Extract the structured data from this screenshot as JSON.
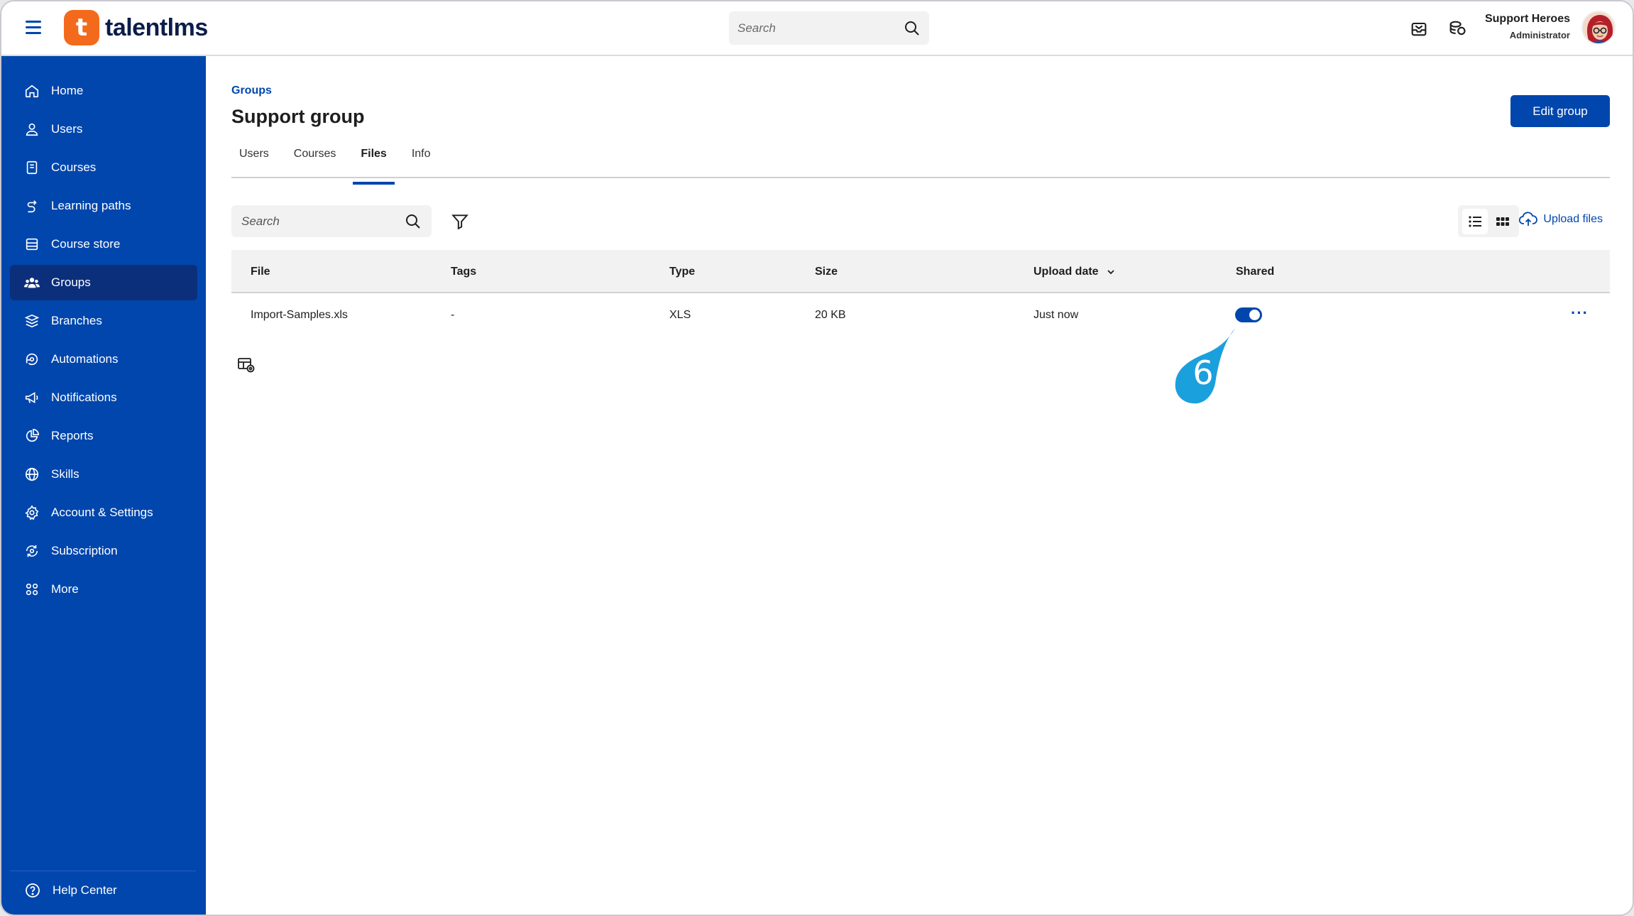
{
  "header": {
    "logo_text": "talentlms",
    "logo_letter": "t",
    "search_placeholder": "Search",
    "user_name": "Support Heroes",
    "user_role": "Administrator"
  },
  "sidebar": {
    "items": [
      {
        "label": "Home",
        "icon": "home-icon"
      },
      {
        "label": "Users",
        "icon": "user-icon"
      },
      {
        "label": "Courses",
        "icon": "book-icon"
      },
      {
        "label": "Learning paths",
        "icon": "path-icon"
      },
      {
        "label": "Course store",
        "icon": "store-icon"
      },
      {
        "label": "Groups",
        "icon": "groups-icon",
        "active": true
      },
      {
        "label": "Branches",
        "icon": "branches-icon"
      },
      {
        "label": "Automations",
        "icon": "automations-icon"
      },
      {
        "label": "Notifications",
        "icon": "megaphone-icon"
      },
      {
        "label": "Reports",
        "icon": "pie-chart-icon"
      },
      {
        "label": "Skills",
        "icon": "globe-icon"
      },
      {
        "label": "Account & Settings",
        "icon": "gear-icon"
      },
      {
        "label": "Subscription",
        "icon": "subscription-icon"
      },
      {
        "label": "More",
        "icon": "grid-icon"
      }
    ],
    "help_label": "Help Center"
  },
  "main": {
    "breadcrumb": "Groups",
    "title": "Support group",
    "edit_button": "Edit group",
    "tabs": [
      {
        "label": "Users"
      },
      {
        "label": "Courses"
      },
      {
        "label": "Files",
        "active": true
      },
      {
        "label": "Info"
      }
    ],
    "files_search_placeholder": "Search",
    "upload_label": "Upload files",
    "table": {
      "headers": {
        "file": "File",
        "tags": "Tags",
        "type": "Type",
        "size": "Size",
        "upload_date": "Upload date",
        "shared": "Shared"
      },
      "rows": [
        {
          "file": "Import-Samples.xls",
          "tags": "-",
          "type": "XLS",
          "size": "20 KB",
          "upload_date": "Just now",
          "shared": true
        }
      ]
    }
  },
  "callout": {
    "number": "6"
  },
  "colors": {
    "primary": "#0046ad",
    "sidebar_active": "#0c2f7c",
    "logo_orange": "#f36a1d",
    "callout": "#1aa0dc"
  }
}
